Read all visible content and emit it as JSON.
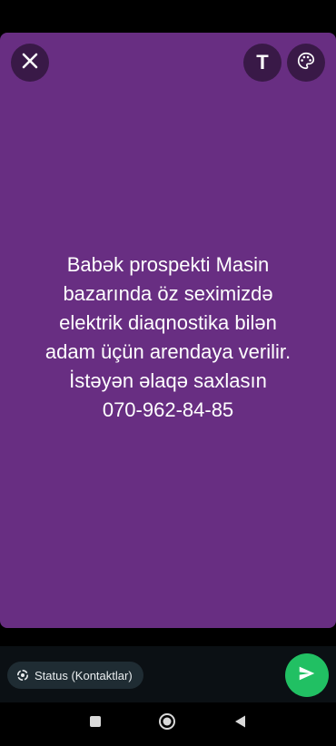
{
  "status": {
    "background_color": "#682e82",
    "text": "Babək prospekti Masin\nbazarında öz seximizdə\nelektrik diaqnostika bilən\nadam üçün arendaya verilir.\nİstəyən əlaqə saxlasın\n070-962-84-85"
  },
  "toolbar": {
    "close_icon": "close-icon",
    "text_tool_glyph": "T",
    "palette_icon": "palette-icon"
  },
  "footer": {
    "audience_label": "Status (Kontaktlar)",
    "audience_icon": "status-ring-icon",
    "send_icon": "send-icon",
    "send_color": "#21c063"
  },
  "navigation": {
    "recents_icon": "recents-square-icon",
    "home_icon": "home-circle-icon",
    "back_icon": "back-triangle-icon"
  }
}
